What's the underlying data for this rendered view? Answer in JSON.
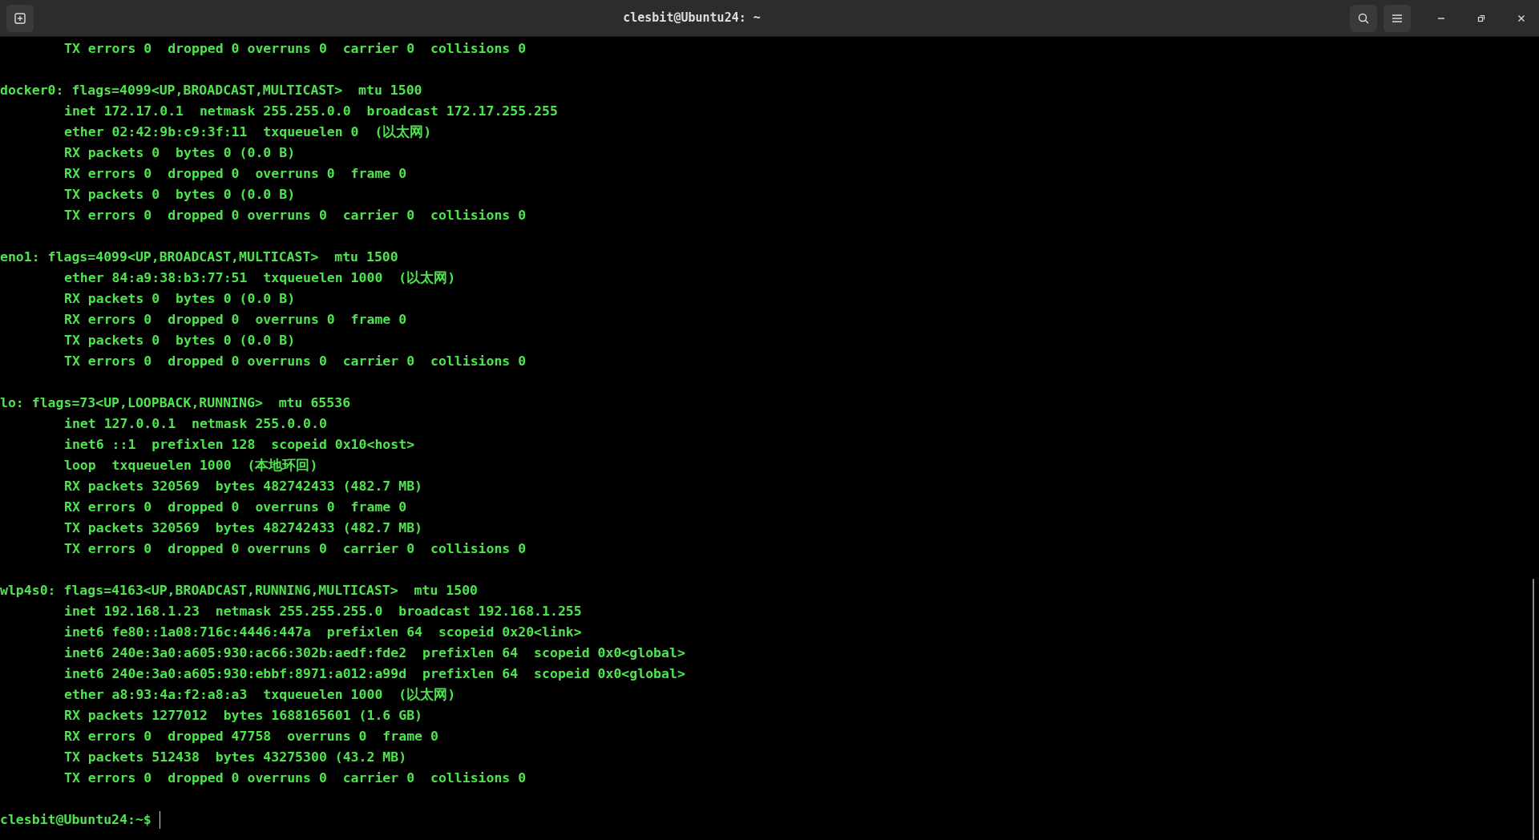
{
  "window": {
    "title": "clesbit@Ubuntu24: ~"
  },
  "output": [
    {
      "details": [
        "TX errors 0  dropped 0 overruns 0  carrier 0  collisions 0"
      ]
    },
    {
      "header": "docker0: flags=4099<UP,BROADCAST,MULTICAST>  mtu 1500",
      "details": [
        "inet 172.17.0.1  netmask 255.255.0.0  broadcast 172.17.255.255",
        "ether 02:42:9b:c9:3f:11  txqueuelen 0  (以太网)",
        "RX packets 0  bytes 0 (0.0 B)",
        "RX errors 0  dropped 0  overruns 0  frame 0",
        "TX packets 0  bytes 0 (0.0 B)",
        "TX errors 0  dropped 0 overruns 0  carrier 0  collisions 0"
      ]
    },
    {
      "header": "eno1: flags=4099<UP,BROADCAST,MULTICAST>  mtu 1500",
      "details": [
        "ether 84:a9:38:b3:77:51  txqueuelen 1000  (以太网)",
        "RX packets 0  bytes 0 (0.0 B)",
        "RX errors 0  dropped 0  overruns 0  frame 0",
        "TX packets 0  bytes 0 (0.0 B)",
        "TX errors 0  dropped 0 overruns 0  carrier 0  collisions 0"
      ]
    },
    {
      "header": "lo: flags=73<UP,LOOPBACK,RUNNING>  mtu 65536",
      "details": [
        "inet 127.0.0.1  netmask 255.0.0.0",
        "inet6 ::1  prefixlen 128  scopeid 0x10<host>",
        "loop  txqueuelen 1000  (本地环回)",
        "RX packets 320569  bytes 482742433 (482.7 MB)",
        "RX errors 0  dropped 0  overruns 0  frame 0",
        "TX packets 320569  bytes 482742433 (482.7 MB)",
        "TX errors 0  dropped 0 overruns 0  carrier 0  collisions 0"
      ]
    },
    {
      "header": "wlp4s0: flags=4163<UP,BROADCAST,RUNNING,MULTICAST>  mtu 1500",
      "details": [
        "inet 192.168.1.23  netmask 255.255.255.0  broadcast 192.168.1.255",
        "inet6 fe80::1a08:716c:4446:447a  prefixlen 64  scopeid 0x20<link>",
        "inet6 240e:3a0:a605:930:ac66:302b:aedf:fde2  prefixlen 64  scopeid 0x0<global>",
        "inet6 240e:3a0:a605:930:ebbf:8971:a012:a99d  prefixlen 64  scopeid 0x0<global>",
        "ether a8:93:4a:f2:a8:a3  txqueuelen 1000  (以太网)",
        "RX packets 1277012  bytes 1688165601 (1.6 GB)",
        "RX errors 0  dropped 47758  overruns 0  frame 0",
        "TX packets 512438  bytes 43275300 (43.2 MB)",
        "TX errors 0  dropped 0 overruns 0  carrier 0  collisions 0"
      ]
    }
  ],
  "prompt": "clesbit@Ubuntu24:~$"
}
